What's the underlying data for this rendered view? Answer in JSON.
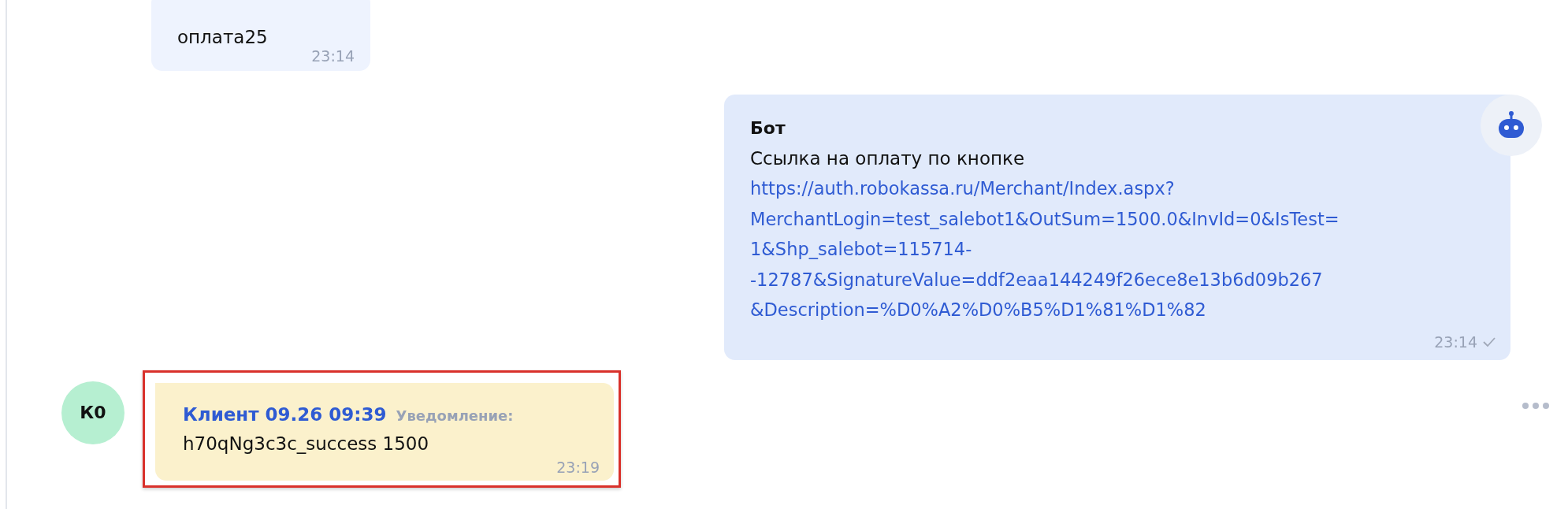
{
  "messages": [
    {
      "kind": "incoming",
      "text": "оплата25",
      "time": "23:14"
    },
    {
      "kind": "bot",
      "author": "Бот",
      "text": "Ссылка на оплату по кнопке",
      "link_lines": [
        "https://auth.robokassa.ru/Merchant/Index.aspx?",
        "MerchantLogin=test_salebot1&OutSum=1500.0&InvId=0&IsTest=",
        "1&Shp_salebot=115714-",
        "-12787&SignatureValue=ddf2eaa144249f26ece8e13b6d09b267",
        "&Description=%D0%A2%D0%B5%D1%81%D1%82"
      ],
      "time": "23:14",
      "read": true
    },
    {
      "kind": "client",
      "avatar": "К0",
      "author": "Клиент 09.26 09:39",
      "label": "Уведомление:",
      "text": "h70qNg3c3c_success 1500",
      "time": "23:19",
      "highlighted": true
    }
  ]
}
